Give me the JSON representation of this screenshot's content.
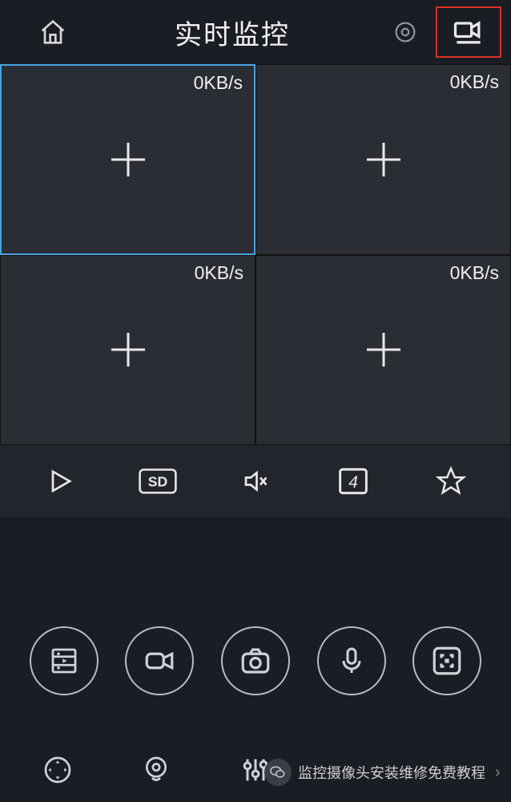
{
  "header": {
    "title": "实时监控"
  },
  "grid": {
    "cells": [
      {
        "rate": "0KB/s",
        "active": true
      },
      {
        "rate": "0KB/s",
        "active": false
      },
      {
        "rate": "0KB/s",
        "active": false
      },
      {
        "rate": "0KB/s",
        "active": false
      }
    ]
  },
  "controls": {
    "quality": "SD",
    "layout": "4"
  },
  "notification": {
    "text": "监控摄像头安装维修免费教程",
    "bubble": "ⓘ"
  }
}
